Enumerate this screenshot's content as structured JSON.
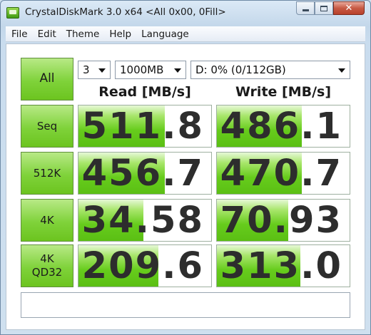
{
  "window": {
    "title": "CrystalDiskMark 3.0 x64 <All 0x00, 0Fill>",
    "close_glyph": "✕"
  },
  "menu": [
    "File",
    "Edit",
    "Theme",
    "Help",
    "Language"
  ],
  "controls": {
    "all_label": "All",
    "count": "3",
    "size": "1000MB",
    "drive": "D: 0% (0/112GB)"
  },
  "headers": {
    "read": "Read [MB/s]",
    "write": "Write [MB/s]"
  },
  "tests": [
    {
      "label": "Seq",
      "read": "511.8",
      "write": "486.1",
      "read_fill": 0.65,
      "write_fill": 0.64
    },
    {
      "label": "512K",
      "read": "456.7",
      "write": "470.7",
      "read_fill": 0.65,
      "write_fill": 0.64
    },
    {
      "label": "4K",
      "read": "34.58",
      "write": "70.93",
      "read_fill": 0.49,
      "write_fill": 0.54
    },
    {
      "label": "4K\nQD32",
      "read": "209.6",
      "write": "313.0",
      "read_fill": 0.6,
      "write_fill": 0.63
    }
  ],
  "colors": {
    "accent_green": "#66cc1c",
    "title_bg": "#c3d7ea"
  }
}
